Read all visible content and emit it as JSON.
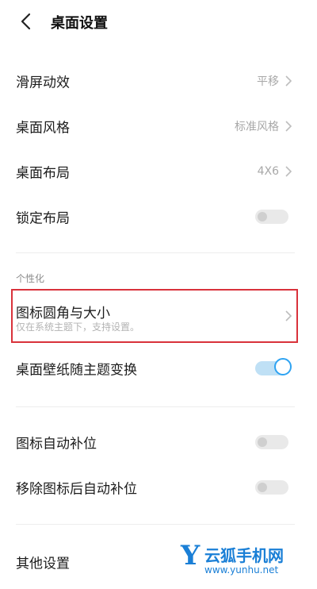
{
  "header": {
    "title": "桌面设置"
  },
  "rows": [
    {
      "label": "滑屏动效",
      "value": "平移"
    },
    {
      "label": "桌面风格",
      "value": "标准风格"
    },
    {
      "label": "桌面布局",
      "value": "4X6"
    },
    {
      "label": "锁定布局",
      "toggle": false
    }
  ],
  "section": {
    "label": "个性化"
  },
  "icon_row": {
    "title": "图标圆角与大小",
    "subtitle": "仅在系统主题下，支持设置。"
  },
  "wallpaper_row": {
    "label": "桌面壁纸随主题变换",
    "toggle": true
  },
  "rows2": [
    {
      "label": "图标自动补位",
      "toggle": false
    },
    {
      "label": "移除图标后自动补位",
      "toggle": false
    }
  ],
  "other": {
    "label": "其他设置"
  },
  "watermark": {
    "logo": "Y",
    "name": "云狐手机网",
    "url": "www.yunhu.net"
  },
  "colors": {
    "accent": "#2ea3f2",
    "highlight_border": "#d9323b",
    "watermark": "#1a7fd6"
  }
}
